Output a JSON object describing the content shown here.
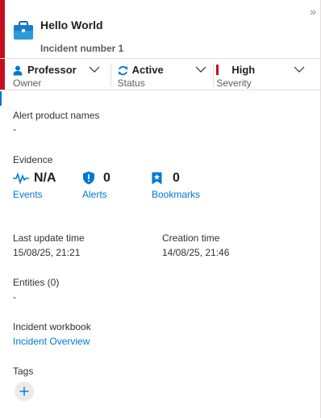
{
  "header": {
    "title": "Hello World",
    "subtitle": "Incident number 1",
    "collapse_glyph": "»",
    "accent_color": "#c50f1f"
  },
  "status": {
    "owner": {
      "value": "Professor",
      "label": "Owner"
    },
    "status": {
      "value": "Active",
      "label": "Status"
    },
    "severity": {
      "value": "High",
      "label": "Severity"
    }
  },
  "details": {
    "alert_product_names": {
      "label": "Alert product names",
      "value": "-"
    },
    "evidence": {
      "label": "Evidence",
      "events": {
        "count": "N/A",
        "label": "Events"
      },
      "alerts": {
        "count": "0",
        "label": "Alerts"
      },
      "bookmarks": {
        "count": "0",
        "label": "Bookmarks"
      }
    },
    "last_update": {
      "label": "Last update time",
      "value": "15/08/25, 21:21"
    },
    "creation": {
      "label": "Creation time",
      "value": "14/08/25, 21:46"
    },
    "entities": {
      "label": "Entities (0)",
      "value": "-"
    },
    "workbook": {
      "label": "Incident workbook",
      "link": "Incident Overview"
    },
    "tags": {
      "label": "Tags"
    }
  },
  "icons": {
    "briefcase": "briefcase-icon",
    "owner": "person-icon",
    "status": "refresh-icon",
    "severity": "severity-bar-icon",
    "events": "pulse-icon",
    "alerts": "shield-alert-icon",
    "bookmarks": "bookmark-star-icon",
    "add_tag": "plus-icon"
  },
  "colors": {
    "link": "#0078d4",
    "severity_high": "#c50f1f"
  }
}
